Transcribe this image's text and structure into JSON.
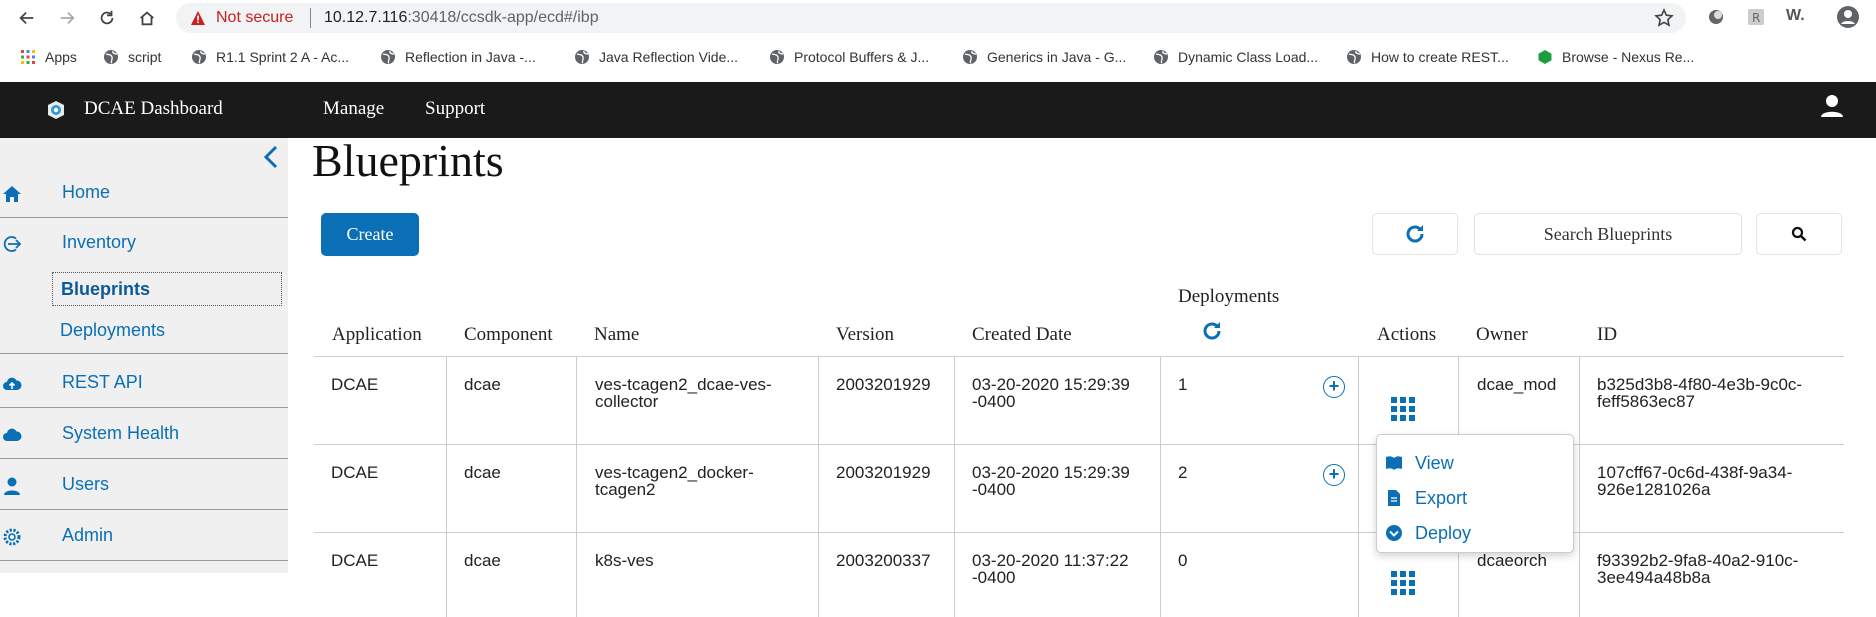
{
  "browser": {
    "security_label": "Not secure",
    "url_host": "10.12.7.116",
    "url_rest": ":30418/ccsdk-app/ecd#/ibp",
    "extension_label": "W."
  },
  "bookmarks": [
    {
      "label": "Apps",
      "icon": "apps-grid-icon"
    },
    {
      "label": "script",
      "icon": "globe-icon"
    },
    {
      "label": "R1.1 Sprint 2 A - Ac...",
      "icon": "globe-icon"
    },
    {
      "label": "Reflection in Java -...",
      "icon": "globe-icon"
    },
    {
      "label": "Java Reflection Vide...",
      "icon": "globe-icon"
    },
    {
      "label": "Protocol Buffers & J...",
      "icon": "globe-icon"
    },
    {
      "label": "Generics in Java - G...",
      "icon": "globe-icon"
    },
    {
      "label": "Dynamic Class Load...",
      "icon": "globe-icon"
    },
    {
      "label": "How to create REST...",
      "icon": "globe-icon"
    },
    {
      "label": "Browse - Nexus Re...",
      "icon": "nexus-icon"
    }
  ],
  "header": {
    "brand": "DCAE Dashboard",
    "nav": [
      "Manage",
      "Support"
    ]
  },
  "sidebar": {
    "items": [
      {
        "label": "Home",
        "icon": "home-icon"
      },
      {
        "label": "Inventory",
        "icon": "inventory-icon"
      },
      {
        "label": "REST API",
        "icon": "cloud-upload-icon"
      },
      {
        "label": "System Health",
        "icon": "cloud-icon"
      },
      {
        "label": "Users",
        "icon": "user-icon"
      },
      {
        "label": "Admin",
        "icon": "gear-icon"
      }
    ],
    "sub_items": [
      {
        "label": "Blueprints",
        "active": true
      },
      {
        "label": "Deployments",
        "active": false
      }
    ]
  },
  "main": {
    "title": "Blueprints",
    "create_label": "Create",
    "search_placeholder": "Search Blueprints",
    "columns": {
      "application": "Application",
      "component": "Component",
      "name": "Name",
      "version": "Version",
      "created_date": "Created Date",
      "deployments": "Deployments",
      "actions": "Actions",
      "owner": "Owner",
      "id": "ID"
    },
    "rows": [
      {
        "application": "DCAE",
        "component": "dcae",
        "name_1": "ves-tcagen2_dcae-ves-",
        "name_2": "collector",
        "version": "2003201929",
        "created_1": "03-20-2020 15:29:39",
        "created_2": "-0400",
        "deployments": "1",
        "owner": "dcae_mod",
        "id_1": "b325d3b8-4f80-4e3b-9c0c-",
        "id_2": "feff5863ec87"
      },
      {
        "application": "DCAE",
        "component": "dcae",
        "name_1": "ves-tcagen2_docker-",
        "name_2": "tcagen2",
        "version": "2003201929",
        "created_1": "03-20-2020 15:29:39",
        "created_2": "-0400",
        "deployments": "2",
        "owner": "",
        "id_1": "107cff67-0c6d-438f-9a34-",
        "id_2": "926e1281026a"
      },
      {
        "application": "DCAE",
        "component": "dcae",
        "name_1": "k8s-ves",
        "name_2": "",
        "version": "2003200337",
        "created_1": "03-20-2020 11:37:22",
        "created_2": "-0400",
        "deployments": "0",
        "owner": "dcaeorch",
        "id_1": "f93392b2-9fa8-40a2-910c-",
        "id_2": "3ee494a48b8a"
      }
    ],
    "action_menu": [
      "View",
      "Export",
      "Deploy"
    ]
  },
  "colors": {
    "accent": "#0b6fb5",
    "header_bg": "#1a1a1a",
    "sidebar_bg": "#f0f0f0",
    "warning": "#c5221f"
  }
}
